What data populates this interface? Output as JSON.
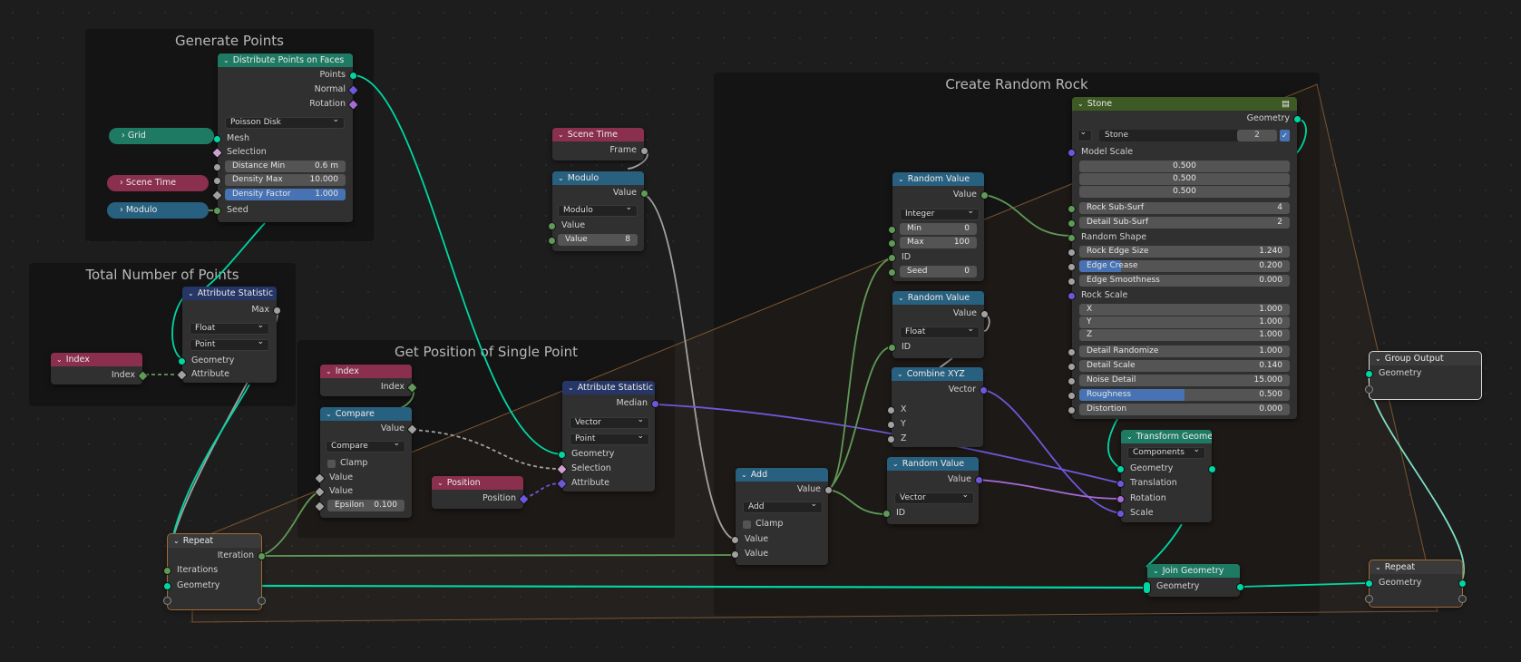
{
  "frames": {
    "generate_points": "Generate Points",
    "total_points": "Total Number of Points",
    "get_position": "Get Position of Single Point",
    "create_rock": "Create Random Rock"
  },
  "nodes": {
    "distribute": {
      "title": "Distribute Points on Faces",
      "points": "Points",
      "normal": "Normal",
      "rotation": "Rotation",
      "mode": "Poisson Disk",
      "mesh": "Mesh",
      "selection": "Selection",
      "distance_min_label": "Distance Min",
      "distance_min": "0.6 m",
      "density_max_label": "Density Max",
      "density_max": "10.000",
      "density_factor_label": "Density Factor",
      "density_factor": "1.000",
      "seed": "Seed"
    },
    "grid": {
      "title": "Grid"
    },
    "scene_time_collapsed": {
      "title": "Scene Time"
    },
    "modulo_collapsed": {
      "title": "Modulo"
    },
    "attr_stat_1": {
      "title": "Attribute Statistic",
      "max": "Max",
      "type": "Float",
      "domain": "Point",
      "geometry": "Geometry",
      "attribute": "Attribute"
    },
    "index_1": {
      "title": "Index",
      "out": "Index"
    },
    "scene_time": {
      "title": "Scene Time",
      "frame": "Frame"
    },
    "modulo": {
      "title": "Modulo",
      "value_out": "Value",
      "op": "Modulo",
      "value_in": "Value",
      "field_label": "Value",
      "field_value": "8"
    },
    "index_2": {
      "title": "Index",
      "out": "Index"
    },
    "compare": {
      "title": "Compare",
      "value_out": "Value",
      "op": "Compare",
      "clamp": "Clamp",
      "a": "Value",
      "b": "Value",
      "epsilon_label": "Epsilon",
      "epsilon": "0.100"
    },
    "position": {
      "title": "Position",
      "out": "Position"
    },
    "attr_stat_2": {
      "title": "Attribute Statistic",
      "median": "Median",
      "type": "Vector",
      "domain": "Point",
      "geometry": "Geometry",
      "selection": "Selection",
      "attribute": "Attribute"
    },
    "repeat_in": {
      "title": "Repeat",
      "iteration": "Iteration",
      "iterations": "Iterations",
      "geometry": "Geometry"
    },
    "add": {
      "title": "Add",
      "value_out": "Value",
      "op": "Add",
      "clamp": "Clamp",
      "a": "Value",
      "b": "Value"
    },
    "random_1": {
      "title": "Random Value",
      "value": "Value",
      "type": "Integer",
      "min_label": "Min",
      "min": "0",
      "max_label": "Max",
      "max": "100",
      "id": "ID",
      "seed_label": "Seed",
      "seed": "0"
    },
    "random_2": {
      "title": "Random Value",
      "value": "Value",
      "type": "Float",
      "id": "ID"
    },
    "combine_xyz": {
      "title": "Combine XYZ",
      "vector": "Vector",
      "x": "X",
      "y": "Y",
      "z": "Z"
    },
    "random_3": {
      "title": "Random Value",
      "value": "Value",
      "type": "Vector",
      "id": "ID"
    },
    "stone": {
      "title": "Stone",
      "geometry": "Geometry",
      "group_name": "Stone",
      "users": "2",
      "model_scale": "Model Scale",
      "ms_values": [
        "0.500",
        "0.500",
        "0.500"
      ],
      "rock_subsurf_label": "Rock Sub-Surf",
      "rock_subsurf": "4",
      "detail_subsurf_label": "Detail Sub-Surf",
      "detail_subsurf": "2",
      "random_shape": "Random Shape",
      "rock_edge_size_label": "Rock Edge Size",
      "rock_edge_size": "1.240",
      "edge_crease_label": "Edge Crease",
      "edge_crease": "0.200",
      "edge_smooth_label": "Edge Smoothness",
      "edge_smooth": "0.000",
      "rock_scale": "Rock Scale",
      "x_label": "X",
      "x": "1.000",
      "y_label": "Y",
      "y": "1.000",
      "z_label": "Z",
      "z": "1.000",
      "detail_random_label": "Detail Randomize",
      "detail_random": "1.000",
      "detail_scale_label": "Detail Scale",
      "detail_scale": "0.140",
      "noise_detail_label": "Noise Detail",
      "noise_detail": "15.000",
      "roughness_label": "Roughness",
      "roughness": "0.500",
      "distortion_label": "Distortion",
      "distortion": "0.000"
    },
    "transform": {
      "title": "Transform Geome...",
      "mode": "Components",
      "geometry": "Geometry",
      "translation": "Translation",
      "rotation": "Rotation",
      "scale": "Scale"
    },
    "join": {
      "title": "Join Geometry",
      "geometry": "Geometry"
    },
    "group_output": {
      "title": "Group Output",
      "geometry": "Geometry"
    },
    "repeat_out": {
      "title": "Repeat",
      "geometry": "Geometry"
    }
  },
  "levels": {
    "edge_crease": 0.2,
    "roughness": 0.5
  },
  "colors": {
    "geometry": "#00d6a3",
    "integer": "#5f9a57",
    "float": "#a1a1a1",
    "vector": "#6d58d9",
    "rotation": "#a56bd6",
    "zone": "#a26a32"
  }
}
